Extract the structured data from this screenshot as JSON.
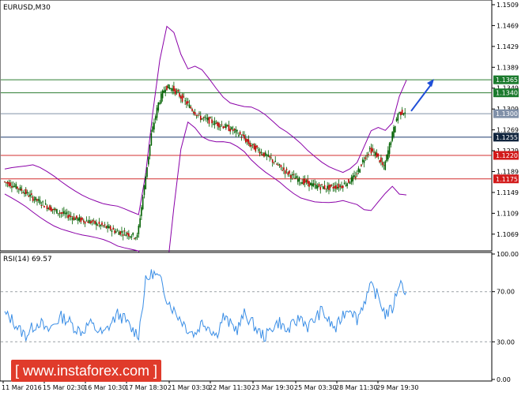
{
  "instrument": {
    "title": "EURUSD,M30"
  },
  "indicator": {
    "title": "RSI(14) 69.57"
  },
  "watermark": {
    "text": "[ www.instaforex.com ]"
  },
  "colors": {
    "candle": "#c00000",
    "wick": "#006000",
    "bollinger": "#8a00a8",
    "rsi": "#3a8ee6",
    "support_resistance_green": "#2e7d32",
    "support_resistance_red": "#d32f2f",
    "pivot": "#1e3a6e",
    "arrow": "#1f4fd8",
    "label_green_bg": "#1b7a2d",
    "label_red_bg": "#d21a1a",
    "label_gray_bg": "#8090a8",
    "label_dark_bg": "#10243d"
  },
  "chart_data": [
    {
      "type": "line",
      "title": "EURUSD,M30",
      "ylim": [
        1.104,
        1.1515
      ],
      "y_ticks": [
        "1.1509",
        "1.1469",
        "1.1429",
        "1.1389",
        "1.1349",
        "1.1309",
        "1.1269",
        "1.1229",
        "1.1189",
        "1.1149",
        "1.1109",
        "1.1069"
      ],
      "y_tick_values": [
        1.1509,
        1.1469,
        1.1429,
        1.1389,
        1.1349,
        1.1309,
        1.1269,
        1.1229,
        1.1189,
        1.1149,
        1.1109,
        1.1069
      ],
      "x_ticks": [
        "11 Mar 2016",
        "15 Mar 02:30",
        "16 Mar 10:30",
        "17 Mar 18:30",
        "21 Mar 03:30",
        "22 Mar 11:30",
        "23 Mar 19:30",
        "25 Mar 03:30",
        "28 Mar 11:30",
        "29 Mar 19:30"
      ],
      "levels": [
        {
          "label": "1.1365",
          "value": 1.1365,
          "kind": "green"
        },
        {
          "label": "1.1340",
          "value": 1.134,
          "kind": "green"
        },
        {
          "label": "1.1300",
          "value": 1.13,
          "kind": "gray"
        },
        {
          "label": "1.1255",
          "value": 1.1255,
          "kind": "dark"
        },
        {
          "label": "1.1220",
          "value": 1.122,
          "kind": "red"
        },
        {
          "label": "1.1175",
          "value": 1.1175,
          "kind": "red"
        }
      ],
      "series": [
        {
          "values": [
            1.117,
            1.1165,
            1.1158,
            1.115,
            1.114,
            1.1132,
            1.1124,
            1.1116,
            1.111,
            1.1106,
            1.11,
            1.1096,
            1.1094,
            1.109,
            1.1085,
            1.108,
            1.1074,
            1.1072,
            1.1068,
            1.1064,
            1.116,
            1.126,
            1.132,
            1.1352,
            1.1348,
            1.1335,
            1.132,
            1.1305,
            1.1292,
            1.1288,
            1.1282,
            1.1278,
            1.1272,
            1.1265,
            1.1255,
            1.124,
            1.1232,
            1.1222,
            1.1212,
            1.12,
            1.119,
            1.118,
            1.1172,
            1.1168,
            1.1162,
            1.116,
            1.1158,
            1.116,
            1.1162,
            1.117,
            1.118,
            1.121,
            1.1232,
            1.122,
            1.1196,
            1.125,
            1.13,
            1.1305
          ]
        }
      ]
    },
    {
      "type": "line",
      "title": "RSI(14) 69.57",
      "ylim": [
        0,
        100
      ],
      "y_ticks": [
        "100.00",
        "70.00",
        "30.00",
        "0.00"
      ],
      "y_tick_values": [
        100,
        70,
        30,
        0
      ],
      "series": [
        {
          "values": [
            52,
            48,
            40,
            35,
            42,
            46,
            38,
            44,
            50,
            47,
            41,
            38,
            45,
            40,
            36,
            44,
            52,
            48,
            40,
            36,
            78,
            85,
            80,
            65,
            55,
            48,
            40,
            36,
            46,
            42,
            35,
            50,
            44,
            40,
            52,
            46,
            38,
            34,
            42,
            46,
            38,
            44,
            50,
            42,
            48,
            55,
            46,
            40,
            52,
            58,
            48,
            62,
            74,
            66,
            52,
            56,
            78,
            70
          ]
        }
      ]
    }
  ]
}
